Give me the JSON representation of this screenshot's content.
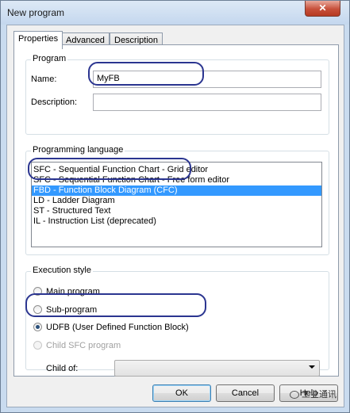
{
  "window": {
    "title": "New program",
    "close_glyph": "✕"
  },
  "tabs": [
    {
      "label": "Properties",
      "active": true
    },
    {
      "label": "Advanced",
      "active": false
    },
    {
      "label": "Description",
      "active": false
    }
  ],
  "program_group": {
    "title": "Program",
    "name_label": "Name:",
    "name_value": "MyFB",
    "description_label": "Description:",
    "description_value": ""
  },
  "language_group": {
    "title": "Programming language",
    "items": [
      {
        "label": "SFC - Sequential Function Chart - Grid editor",
        "selected": false
      },
      {
        "label": "SFC - Sequential Function Chart - Free form editor",
        "selected": false
      },
      {
        "label": "FBD - Function Block Diagram (CFC)",
        "selected": true
      },
      {
        "label": "LD - Ladder Diagram",
        "selected": false
      },
      {
        "label": "ST - Structured Text",
        "selected": false
      },
      {
        "label": "IL - Instruction List (deprecated)",
        "selected": false
      }
    ]
  },
  "execution_group": {
    "title": "Execution style",
    "options": [
      {
        "label": "Main program",
        "checked": false,
        "disabled": false
      },
      {
        "label": "Sub-program",
        "checked": false,
        "disabled": false
      },
      {
        "label": "UDFB (User Defined Function Block)",
        "checked": true,
        "disabled": false
      },
      {
        "label": "Child SFC program",
        "checked": false,
        "disabled": true
      }
    ],
    "child_of_label": "Child of:",
    "child_of_value": ""
  },
  "buttons": {
    "ok": "OK",
    "cancel": "Cancel",
    "help": "Help"
  },
  "watermark": "工业通讯",
  "colors": {
    "selection": "#3399ff",
    "annotation": "#2b3590"
  }
}
